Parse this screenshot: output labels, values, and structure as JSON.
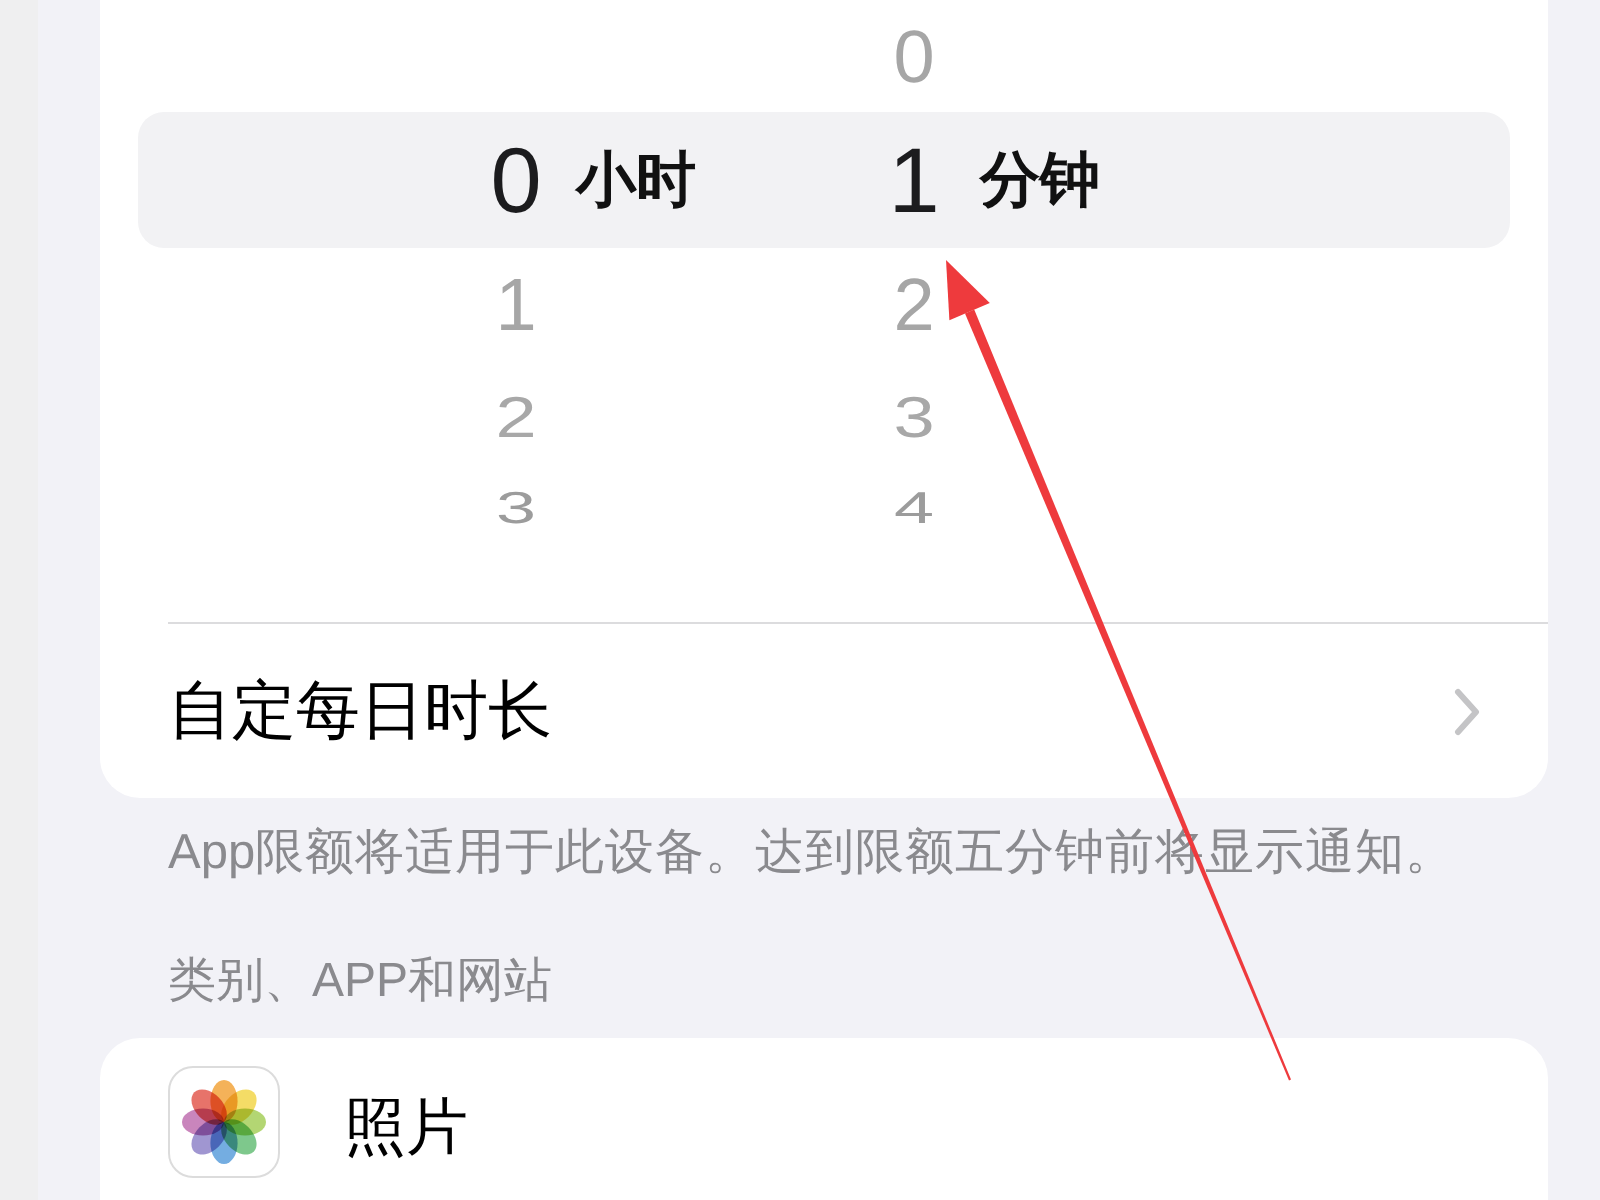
{
  "picker": {
    "columns": [
      {
        "unit": "小时",
        "items": [
          {
            "value": "0",
            "selected": true
          },
          {
            "value": "1",
            "selected": false
          },
          {
            "value": "2",
            "selected": false
          },
          {
            "value": "3",
            "selected": false
          }
        ]
      },
      {
        "unit": "分钟",
        "items": [
          {
            "value": "0",
            "selected": false
          },
          {
            "value": "1",
            "selected": true
          },
          {
            "value": "2",
            "selected": false
          },
          {
            "value": "3",
            "selected": false
          },
          {
            "value": "4",
            "selected": false
          }
        ]
      }
    ]
  },
  "custom_row": {
    "label": "自定每日时长"
  },
  "footnote": "App限额将适用于此设备。达到限额五分钟前将显示通知。",
  "section_header": "类别、APP和网站",
  "apps": [
    {
      "name": "照片"
    }
  ]
}
